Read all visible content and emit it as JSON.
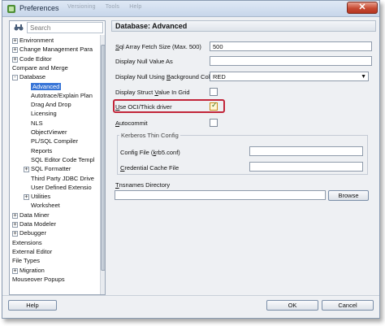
{
  "window": {
    "title": "Preferences",
    "ghost_menu": [
      "Versioning",
      "Tools",
      "Help"
    ],
    "close_label": "✕"
  },
  "search": {
    "placeholder": "Search"
  },
  "tree": [
    {
      "label": "Environment",
      "level": 0,
      "expander": "+"
    },
    {
      "label": "Change Management Para",
      "level": 0,
      "expander": "+"
    },
    {
      "label": "Code Editor",
      "level": 0,
      "expander": "+"
    },
    {
      "label": "Compare and Merge",
      "level": 0,
      "expander": ""
    },
    {
      "label": "Database",
      "level": 0,
      "expander": "-"
    },
    {
      "label": "Advanced",
      "level": 1,
      "expander": "",
      "selected": true
    },
    {
      "label": "Autotrace/Explain Plan",
      "level": 1,
      "expander": ""
    },
    {
      "label": "Drag And Drop",
      "level": 1,
      "expander": ""
    },
    {
      "label": "Licensing",
      "level": 1,
      "expander": ""
    },
    {
      "label": "NLS",
      "level": 1,
      "expander": ""
    },
    {
      "label": "ObjectViewer",
      "level": 1,
      "expander": ""
    },
    {
      "label": "PL/SQL Compiler",
      "level": 1,
      "expander": ""
    },
    {
      "label": "Reports",
      "level": 1,
      "expander": ""
    },
    {
      "label": "SQL Editor Code Templ",
      "level": 1,
      "expander": ""
    },
    {
      "label": "SQL Formatter",
      "level": 1,
      "expander": "+"
    },
    {
      "label": "Third Party JDBC Drive",
      "level": 1,
      "expander": ""
    },
    {
      "label": "User Defined Extensio",
      "level": 1,
      "expander": ""
    },
    {
      "label": "Utilities",
      "level": 1,
      "expander": "+"
    },
    {
      "label": "Worksheet",
      "level": 1,
      "expander": ""
    },
    {
      "label": "Data Miner",
      "level": 0,
      "expander": "+"
    },
    {
      "label": "Data Modeler",
      "level": 0,
      "expander": "+"
    },
    {
      "label": "Debugger",
      "level": 0,
      "expander": "+"
    },
    {
      "label": "Extensions",
      "level": 0,
      "expander": ""
    },
    {
      "label": "External Editor",
      "level": 0,
      "expander": ""
    },
    {
      "label": "File Types",
      "level": 0,
      "expander": ""
    },
    {
      "label": "Migration",
      "level": 0,
      "expander": "+"
    },
    {
      "label": "Mouseover Popups",
      "level": 0,
      "expander": ""
    }
  ],
  "page": {
    "title": "Database: Advanced",
    "sql_fetch_label_pre": "S",
    "sql_fetch_label_rest": "ql Array Fetch Size (Max. 500)",
    "sql_fetch_value": "500",
    "null_value_label": "Display Null Value As",
    "null_value_value": "",
    "null_bg_label_pre": "Display Null Using ",
    "null_bg_label_u": "B",
    "null_bg_label_rest": "ackground Color",
    "null_bg_value": "RED",
    "struct_label_pre": "Display Struct ",
    "struct_label_u": "V",
    "struct_label_rest": "alue In Grid",
    "oci_label_pre": "",
    "oci_label_u": "U",
    "oci_label_rest": "se OCI/Thick driver",
    "autocommit_label_u": "A",
    "autocommit_label_rest": "utocommit",
    "kerberos_title": "Kerberos Thin Config",
    "config_file_label_pre": "Config File (",
    "config_file_label_u": "k",
    "config_file_label_rest": "rb5.conf)",
    "config_file_value": "",
    "cred_cache_label_pre": "",
    "cred_cache_label_u": "C",
    "cred_cache_label_rest": "redential Cache File",
    "cred_cache_value": "",
    "tnsnames_label_u": "T",
    "tnsnames_label_rest": "nsnames Directory",
    "tnsnames_value": "",
    "browse_label": "Browse",
    "struct_checked": false,
    "oci_checked": true,
    "autocommit_checked": false
  },
  "buttons": {
    "help": "Help",
    "ok": "OK",
    "cancel": "Cancel"
  },
  "colors": {
    "selection": "#3875d7",
    "highlight_border": "#c2263a"
  }
}
